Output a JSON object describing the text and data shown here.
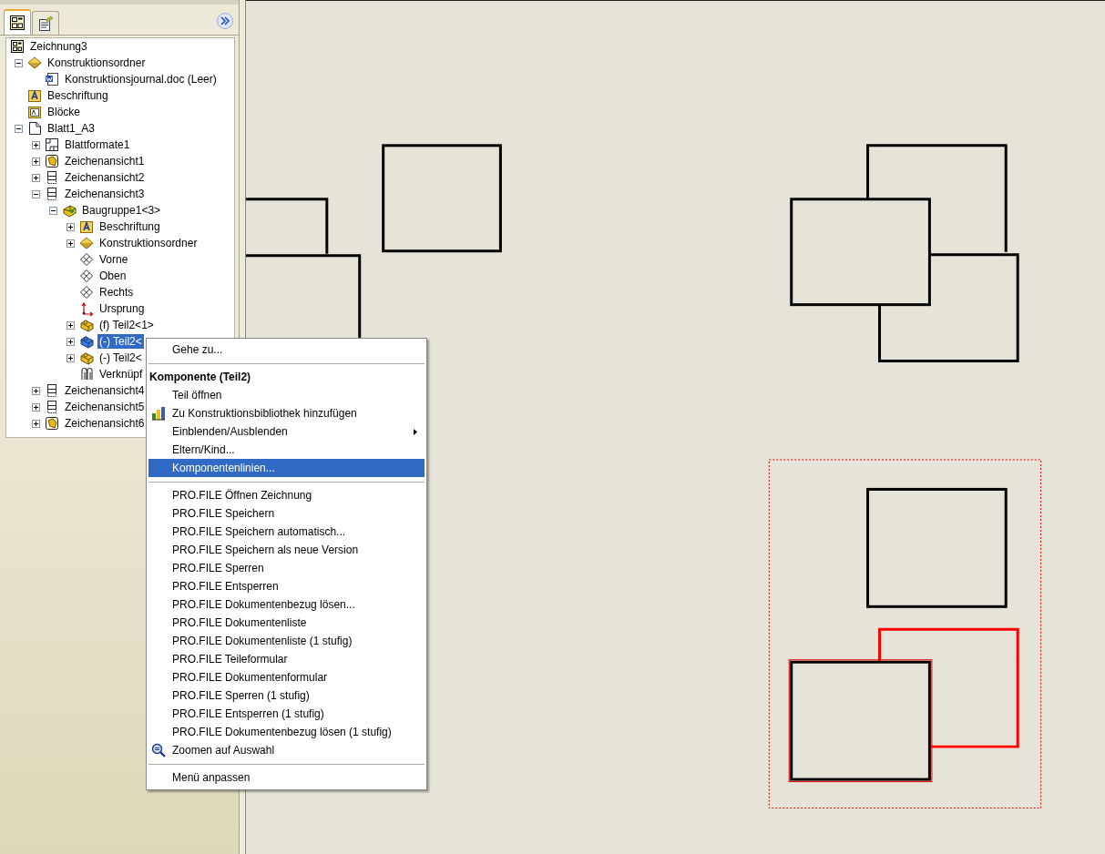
{
  "panel_tabs": [
    {
      "selected": true
    },
    {
      "selected": false
    }
  ],
  "tree": {
    "label": "Zeichnung3",
    "kind": "drawing",
    "children": [
      {
        "label": "Konstruktionsordner",
        "kind": "design-folder",
        "expanded": true,
        "children": [
          {
            "label": "Konstruktionsjournal.doc (Leer)",
            "kind": "document"
          }
        ]
      },
      {
        "label": "Beschriftung",
        "kind": "annotation"
      },
      {
        "label": "Blöcke",
        "kind": "blocks"
      },
      {
        "label": "Blatt1_A3",
        "kind": "sheet",
        "expanded": true,
        "children": [
          {
            "label": "Blattformate1",
            "kind": "sheet-format",
            "expanded": false
          },
          {
            "label": "Zeichenansicht1",
            "kind": "view-part",
            "expanded": false
          },
          {
            "label": "Zeichenansicht2",
            "kind": "view",
            "expanded": false
          },
          {
            "label": "Zeichenansicht3",
            "kind": "view",
            "expanded": true,
            "children": [
              {
                "label": "Baugruppe1<3>",
                "kind": "assembly",
                "expanded": true,
                "children": [
                  {
                    "label": "Beschriftung",
                    "kind": "annotation",
                    "expanded": false
                  },
                  {
                    "label": "Konstruktionsordner",
                    "kind": "design-folder",
                    "expanded": false
                  },
                  {
                    "label": "Vorne",
                    "kind": "plane"
                  },
                  {
                    "label": "Oben",
                    "kind": "plane"
                  },
                  {
                    "label": "Rechts",
                    "kind": "plane"
                  },
                  {
                    "label": "Ursprung",
                    "kind": "origin"
                  },
                  {
                    "label": "(f) Teil2<1>",
                    "kind": "part",
                    "expanded": false,
                    "selected": false
                  },
                  {
                    "label": "(-) Teil2<",
                    "kind": "part",
                    "expanded": false,
                    "selected": true
                  },
                  {
                    "label": "(-) Teil2<",
                    "kind": "part",
                    "expanded": false,
                    "selected": false
                  },
                  {
                    "label": "Verknüpf",
                    "kind": "mates"
                  }
                ]
              }
            ]
          },
          {
            "label": "Zeichenansicht4",
            "kind": "view",
            "expanded": false
          },
          {
            "label": "Zeichenansicht5",
            "kind": "view",
            "expanded": false
          },
          {
            "label": "Zeichenansicht6",
            "kind": "view-part",
            "expanded": false
          }
        ]
      }
    ]
  },
  "context_menu": [
    {
      "kind": "item",
      "label": "Gehe zu..."
    },
    {
      "kind": "separator"
    },
    {
      "kind": "header",
      "label": "Komponente (Teil2)"
    },
    {
      "kind": "item",
      "label": "Teil öffnen"
    },
    {
      "kind": "library-item",
      "label": "Zu Konstruktionsbibliothek hinzufügen"
    },
    {
      "kind": "item",
      "label": "Einblenden/Ausblenden",
      "submenu": true
    },
    {
      "kind": "item",
      "label": "Eltern/Kind..."
    },
    {
      "kind": "item",
      "label": "Komponentenlinien...",
      "selected": true
    },
    {
      "kind": "separator"
    },
    {
      "kind": "item",
      "label": "PRO.FILE Öffnen Zeichnung"
    },
    {
      "kind": "item",
      "label": "PRO.FILE Speichern"
    },
    {
      "kind": "item",
      "label": "PRO.FILE Speichern automatisch..."
    },
    {
      "kind": "item",
      "label": "PRO.FILE Speichern als neue Version"
    },
    {
      "kind": "item",
      "label": "PRO.FILE Sperren"
    },
    {
      "kind": "item",
      "label": "PRO.FILE Entsperren"
    },
    {
      "kind": "item",
      "label": "PRO.FILE Dokumentenbezug lösen..."
    },
    {
      "kind": "item",
      "label": "PRO.FILE Dokumentenliste"
    },
    {
      "kind": "item",
      "label": "PRO.FILE Dokumentenliste (1 stufig)"
    },
    {
      "kind": "item",
      "label": "PRO.FILE Teileformular"
    },
    {
      "kind": "item",
      "label": "PRO.FILE Dokumentenformular"
    },
    {
      "kind": "item",
      "label": "PRO.FILE Sperren (1 stufig)"
    },
    {
      "kind": "item",
      "label": "PRO.FILE Entsperren (1 stufig)"
    },
    {
      "kind": "item",
      "label": "PRO.FILE Dokumentenbezug lösen (1 stufig)"
    },
    {
      "kind": "zoom-item",
      "label": "Zoomen auf Auswahl"
    },
    {
      "kind": "separator"
    },
    {
      "kind": "item",
      "label": "Menü anpassen"
    }
  ]
}
